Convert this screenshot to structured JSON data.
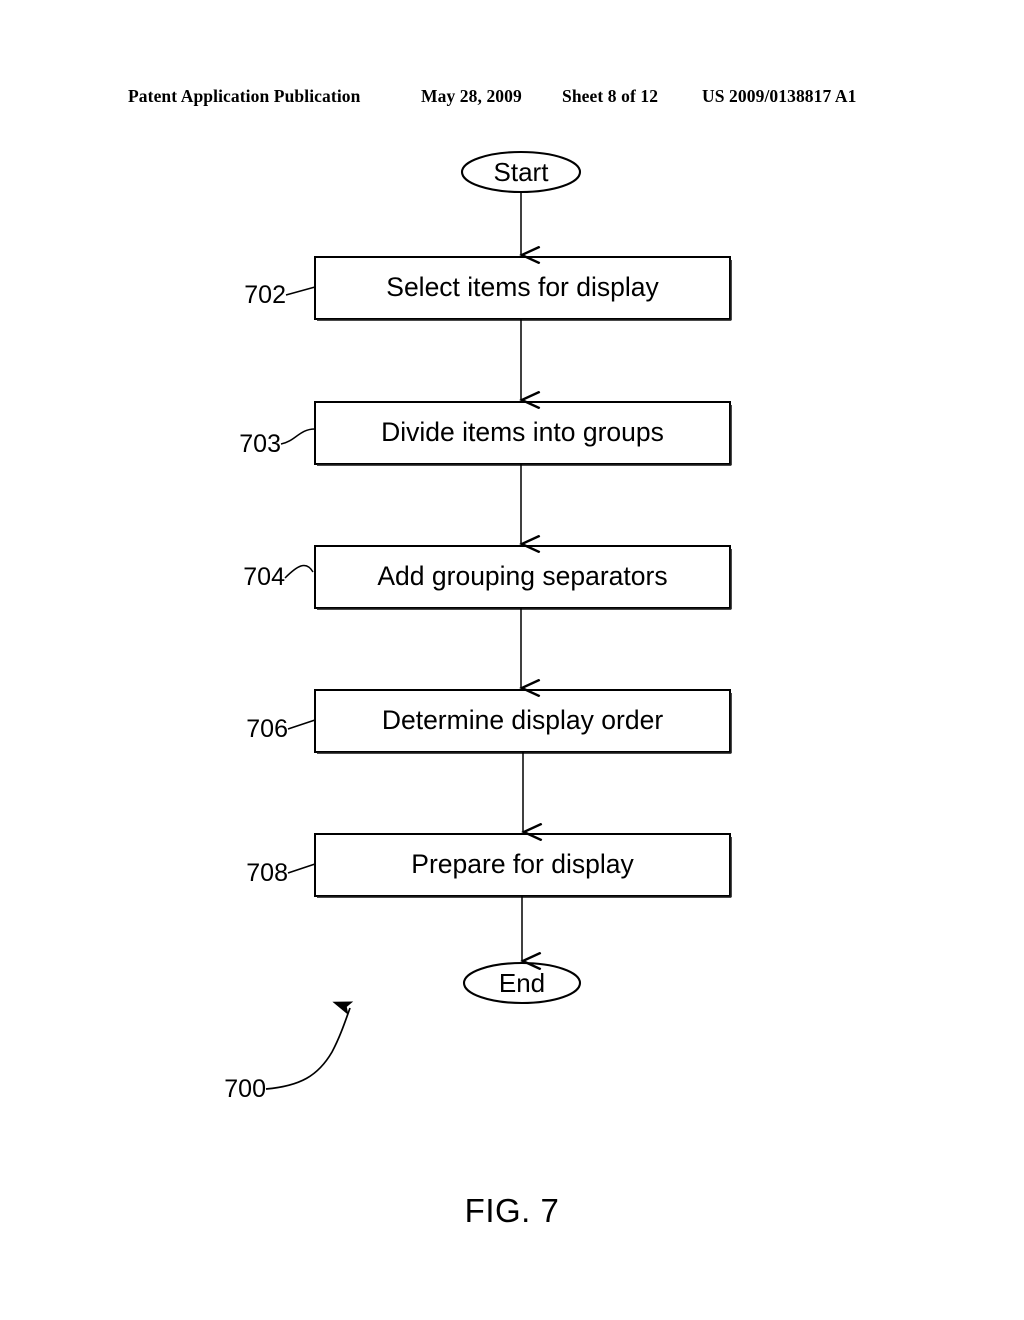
{
  "header": {
    "publication": "Patent Application Publication",
    "date": "May 28, 2009",
    "sheet": "Sheet 8 of 12",
    "document_number": "US 2009/0138817 A1"
  },
  "figure": {
    "caption": "FIG. 7",
    "overall_reference": "700",
    "start_terminator": "Start",
    "end_terminator": "End",
    "steps": [
      {
        "ref": "702",
        "label": "Select items for display"
      },
      {
        "ref": "703",
        "label": "Divide items into groups"
      },
      {
        "ref": "704",
        "label": "Add grouping separators"
      },
      {
        "ref": "706",
        "label": "Determine display order"
      },
      {
        "ref": "708",
        "label": "Prepare for display"
      }
    ]
  },
  "style": {
    "ink": "#000000",
    "paper": "#ffffff"
  }
}
